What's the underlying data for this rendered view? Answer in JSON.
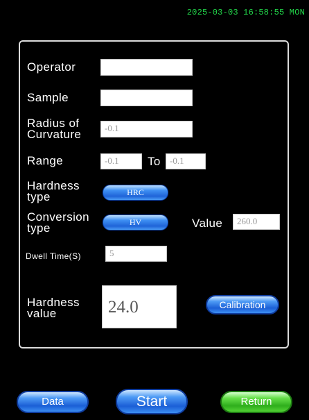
{
  "header": {
    "datetime": "2025-03-03 16:58:55 MON"
  },
  "form": {
    "operator": {
      "label": "Operator",
      "value": ""
    },
    "sample": {
      "label": "Sample",
      "value": ""
    },
    "radius": {
      "label_line1": "Radius of",
      "label_line2": "Curvature",
      "value": "-0.1"
    },
    "range": {
      "label": "Range",
      "from": "-0.1",
      "to_label": "To",
      "to": "-0.1"
    },
    "hardness_type": {
      "label_line1": "Hardness",
      "label_line2": "type",
      "value": "HRC"
    },
    "conversion_type": {
      "label_line1": "Conversion",
      "label_line2": "type",
      "value": "HV"
    },
    "conversion_value": {
      "label": "Value",
      "value": "260.0"
    },
    "dwell_time": {
      "label": "Dwell Time(S)",
      "value": "5"
    },
    "hardness_value": {
      "label_line1": "Hardness",
      "label_line2": "value",
      "value": "24.0"
    },
    "calibration_label": "Calibration"
  },
  "footer": {
    "data_label": "Data",
    "start_label": "Start",
    "return_label": "Return"
  },
  "colors": {
    "datetime": "#22d84a",
    "button_blue": "#1f64d8",
    "button_green": "#2fae1c",
    "background": "#000000"
  }
}
